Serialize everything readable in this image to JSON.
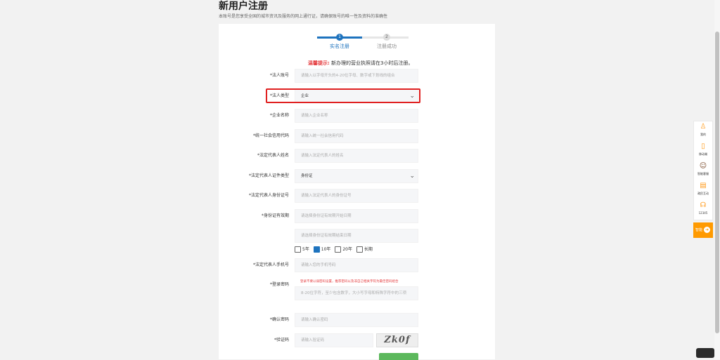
{
  "header": {
    "title": "新用户注册",
    "subtitle": "本账号是您享受全国的城市资讯及服务的网上通行证，请确保账号的唯一性及资料的准确性"
  },
  "steps": [
    {
      "number": "1",
      "label": "实名注册",
      "active": true
    },
    {
      "number": "2",
      "label": "注册成功",
      "active": false
    }
  ],
  "notice": {
    "prefix": "温馨提示:",
    "text": " 新办理的营业执照请在3小时后注册。"
  },
  "fields": {
    "account": {
      "label": "*法人账号",
      "placeholder": "请输入以字母开头的4-20位字母、数字或下划线的组合"
    },
    "type": {
      "label": "*法人类型",
      "value": "企业"
    },
    "company": {
      "label": "*企业名称",
      "placeholder": "请输入企业名称"
    },
    "credit_code": {
      "label": "*统一社会信用代码",
      "placeholder": "请输入统一社会信用代码"
    },
    "rep_name": {
      "label": "*法定代表人姓名",
      "placeholder": "请输入法定代表人的姓名"
    },
    "id_type": {
      "label": "*法定代表人证件类型",
      "value": "身份证"
    },
    "id_number": {
      "label": "*法定代表人身份证号",
      "placeholder": "请输入法定代表人的身份证号"
    },
    "validity": {
      "label": "*身份证有效期",
      "placeholder_start": "请选择身份证有效期开始日期",
      "placeholder_end": "请选择身份证有效期结束日期"
    },
    "phone": {
      "label": "*法定代表人手机号",
      "placeholder": "请输入您的手机号码"
    },
    "password": {
      "label": "*登录密码",
      "warning": "登录不要以弱密码设置，推荐密码以及非自己相关字符为最佳密码组合",
      "placeholder": "8-20位字符，至少包含数字，大小写字母和特殊字符中的三项"
    },
    "confirm": {
      "label": "*确认密码",
      "placeholder": "请输入确认密码"
    },
    "captcha": {
      "label": "*验证码",
      "placeholder": "请输入验证码",
      "image_text": "Zk0f"
    }
  },
  "validity_options": [
    {
      "label": "5年",
      "checked": false
    },
    {
      "label": "10年",
      "checked": true
    },
    {
      "label": "20年",
      "checked": false
    },
    {
      "label": "长期",
      "checked": false
    }
  ],
  "sidebar": {
    "items": [
      {
        "icon": "user-icon",
        "label": "我的"
      },
      {
        "icon": "mobile-icon",
        "label": "移动端"
      },
      {
        "icon": "assistant-icon",
        "label": "智能客服"
      },
      {
        "icon": "feedback-icon",
        "label": "政民互动"
      },
      {
        "icon": "headset-icon",
        "label": "12345"
      }
    ],
    "back_label": "智能"
  },
  "colors": {
    "accent": "#1e73be",
    "highlight": "#e02020",
    "warning": "#e4393c",
    "orange": "#ff9a00"
  }
}
